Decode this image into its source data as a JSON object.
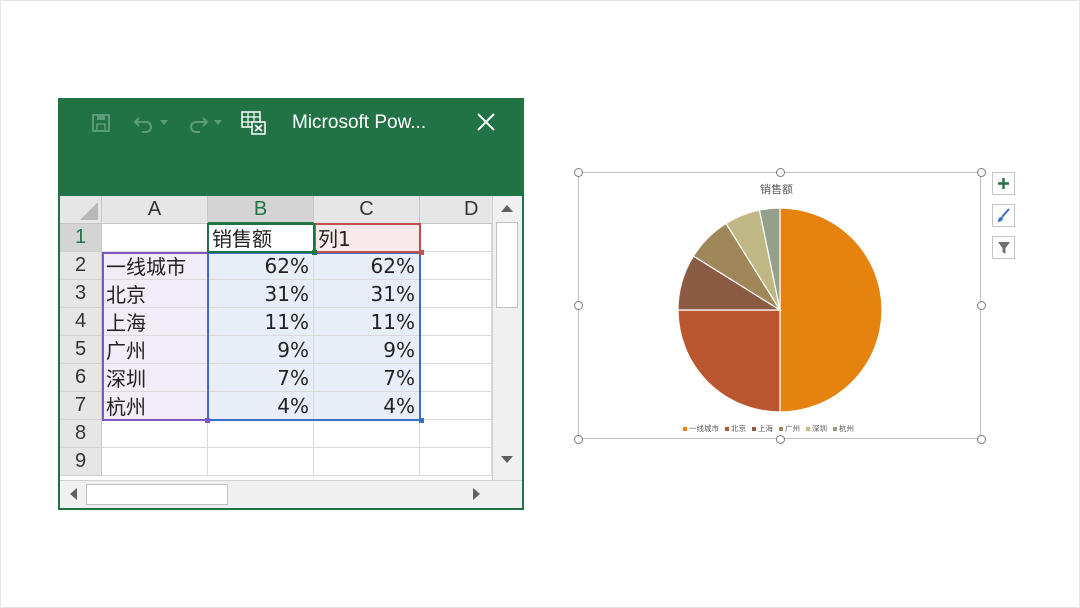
{
  "excel": {
    "title": "Microsoft Pow...",
    "toolbar": {
      "save_icon": "save-icon",
      "undo_icon": "undo-icon",
      "redo_icon": "redo-icon",
      "edit_data_icon": "edit-data-in-excel-icon",
      "close_icon": "close-icon"
    },
    "columns": [
      "A",
      "B",
      "C",
      "D"
    ],
    "rows": [
      "1",
      "2",
      "3",
      "4",
      "5",
      "6",
      "7",
      "8",
      "9"
    ],
    "header": {
      "b": "销售额",
      "c": "列1"
    },
    "data": [
      {
        "a": "一线城市",
        "b": "62%",
        "c": "62%"
      },
      {
        "a": "北京",
        "b": "31%",
        "c": "31%"
      },
      {
        "a": "上海",
        "b": "11%",
        "c": "11%"
      },
      {
        "a": "广州",
        "b": "9%",
        "c": "9%"
      },
      {
        "a": "深圳",
        "b": "7%",
        "c": "7%"
      },
      {
        "a": "杭州",
        "b": "4%",
        "c": "4%"
      }
    ],
    "colors": {
      "window": "#217346",
      "range_a": "#7e57c2",
      "range_b": "#3b6fc6",
      "range_c": "#c0504d",
      "active": "#217346"
    }
  },
  "chart_data": {
    "type": "pie",
    "title": "销售额",
    "categories": [
      "一线城市",
      "北京",
      "上海",
      "广州",
      "深圳",
      "杭州"
    ],
    "values": [
      62,
      31,
      11,
      9,
      7,
      4
    ],
    "colors": [
      "#E6820E",
      "#BA5730",
      "#8B5A42",
      "#A0875A",
      "#BFB885",
      "#94A08C"
    ],
    "legend_position": "bottom"
  },
  "chart_tools": {
    "elements_icon": "plus-icon",
    "styles_icon": "brush-icon",
    "filters_icon": "filter-icon"
  }
}
